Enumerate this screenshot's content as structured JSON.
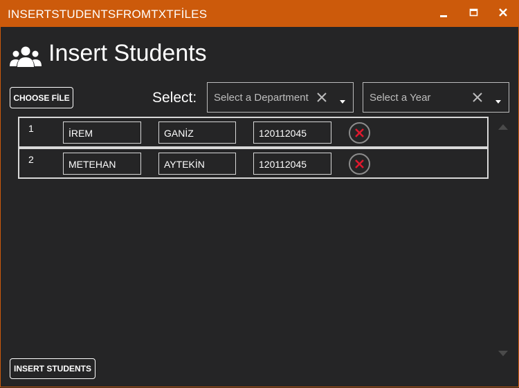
{
  "window": {
    "title": "INSERTSTUDENTSFROMTXTFİLES",
    "icons": [
      "minimize-icon",
      "maximize-icon",
      "close-icon"
    ]
  },
  "header": {
    "title": "Insert Students",
    "icon": "users-icon"
  },
  "toolbar": {
    "choose_file_label": "CHOOSE FİLE",
    "select_label": "Select:",
    "department_placeholder": "Select a Department",
    "year_placeholder": "Select a Year"
  },
  "students": [
    {
      "index": "1",
      "first_name": "İREM",
      "last_name": "GANİZ",
      "student_no": "120112045"
    },
    {
      "index": "2",
      "first_name": "METEHAN",
      "last_name": "AYTEKİN",
      "student_no": "120112045"
    }
  ],
  "footer": {
    "insert_label": "INSERT STUDENTS"
  },
  "colors": {
    "accent": "#CC5A0B",
    "background": "#252526",
    "delete": "#E0182D"
  }
}
